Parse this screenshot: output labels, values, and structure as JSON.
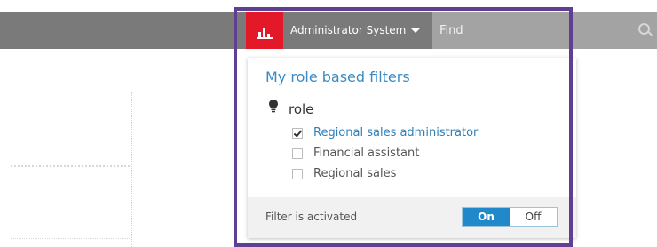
{
  "header": {
    "user_menu_label": "Administrator System",
    "search_placeholder": "Find"
  },
  "filters_dropdown": {
    "title": "My role based filters",
    "group": {
      "label": "role",
      "options": [
        {
          "label": "Regional sales administrator",
          "checked": true
        },
        {
          "label": "Financial assistant",
          "checked": false
        },
        {
          "label": "Regional sales",
          "checked": false
        }
      ]
    },
    "footer": {
      "status_label": "Filter is activated",
      "toggle_on_label": "On",
      "toggle_off_label": "Off",
      "active": "On"
    }
  },
  "colors": {
    "topbar": "#7a7a7a",
    "brand_red": "#e3192a",
    "accent_blue": "#2188c9",
    "highlight_frame": "#5f3f91"
  }
}
